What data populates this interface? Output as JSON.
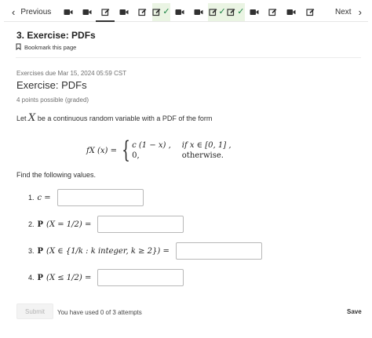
{
  "nav": {
    "previous_label": "Previous",
    "next_label": "Next",
    "units": [
      {
        "icon": "video-icon",
        "done": false,
        "active": false
      },
      {
        "icon": "video-icon",
        "done": false,
        "active": false
      },
      {
        "icon": "edit-icon",
        "done": false,
        "active": true
      },
      {
        "icon": "video-icon",
        "done": false,
        "active": false
      },
      {
        "icon": "edit-icon",
        "done": false,
        "active": false
      },
      {
        "icon": "edit-icon",
        "done": true,
        "active": false
      },
      {
        "icon": "video-icon",
        "done": false,
        "active": false
      },
      {
        "icon": "video-icon",
        "done": false,
        "active": false
      },
      {
        "icon": "edit-icon",
        "done": true,
        "active": false
      },
      {
        "icon": "edit-icon",
        "done": true,
        "active": false
      },
      {
        "icon": "video-icon",
        "done": false,
        "active": false
      },
      {
        "icon": "edit-icon",
        "done": false,
        "active": false
      },
      {
        "icon": "video-icon",
        "done": false,
        "active": false
      },
      {
        "icon": "edit-icon",
        "done": false,
        "active": false
      }
    ]
  },
  "sequence_title": "3. Exercise: PDFs",
  "bookmark_label": "Bookmark this page",
  "problem": {
    "due": "Exercises due Mar 15, 2024 05:59 CST",
    "title": "Exercise: PDFs",
    "points": "4 points possible (graded)",
    "statement_before": "Let",
    "statement_var": "X",
    "statement_after": "be a continuous random variable with a PDF of the form",
    "formula": {
      "lhs": "fX (x) =",
      "case1_expr": "c (1 − x) ,",
      "case1_cond": "if x ∈ [0, 1] ,",
      "case2_expr": "0,",
      "case2_cond": "otherwise."
    },
    "find_label": "Find the following values."
  },
  "questions": [
    {
      "num": "1.",
      "expr": "c =",
      "value": ""
    },
    {
      "num": "2.",
      "expr": "(X = 1/2) =",
      "value": ""
    },
    {
      "num": "3.",
      "expr": "(X ∈ {1/k : k integer, k ≥ 2}) =",
      "value": ""
    },
    {
      "num": "4.",
      "expr": "(X ≤ 1/2) =",
      "value": ""
    }
  ],
  "prob_symbol": "P",
  "footer": {
    "submit_label": "Submit",
    "attempts": "You have used 0 of 3 attempts",
    "save_label": "Save"
  },
  "colors": {
    "done_bg": "#eaf4e3",
    "check": "#178040",
    "text": "#313131"
  }
}
